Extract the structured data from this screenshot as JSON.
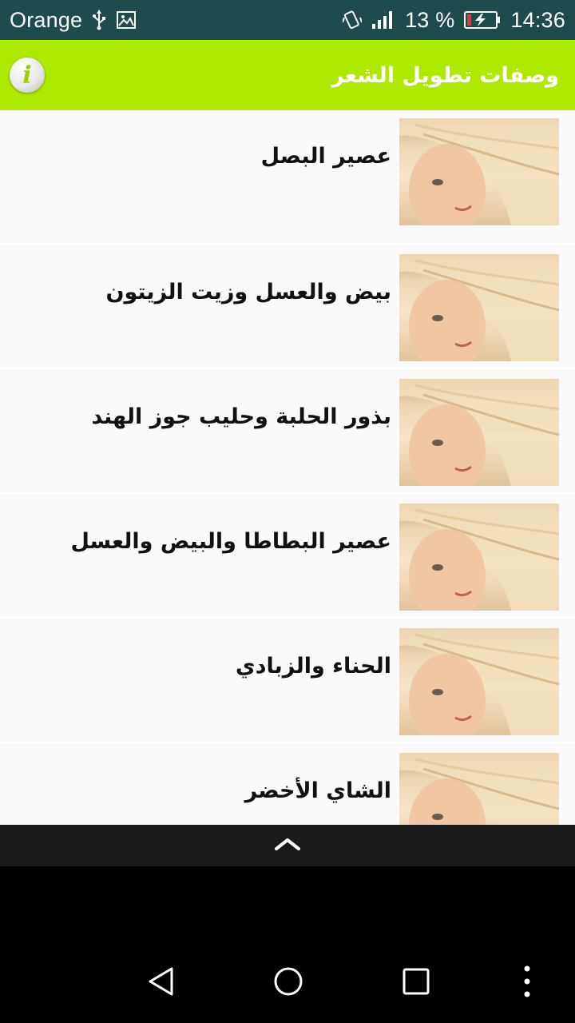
{
  "status_bar": {
    "carrier": "Orange",
    "battery_percent": "13 %",
    "time": "14:36",
    "icons": [
      "usb-icon",
      "image-icon",
      "vibrate-icon",
      "signal-icon",
      "battery-charging-icon"
    ]
  },
  "app_bar": {
    "title": "وصفات تطويل الشعر",
    "info_icon": "info-icon",
    "info_glyph": "i"
  },
  "list": {
    "items": [
      {
        "label": "عصير البصل"
      },
      {
        "label": "بيض والعسل وزيت الزيتون"
      },
      {
        "label": "بذور الحلبة وحليب جوز الهند"
      },
      {
        "label": "عصير البطاطا والبيض والعسل"
      },
      {
        "label": "الحناء والزبادي"
      },
      {
        "label": "الشاي الأخضر"
      }
    ]
  },
  "navigation": {
    "expand_icon": "chevron-up-icon",
    "buttons": [
      "back-icon",
      "home-icon",
      "recents-icon",
      "menu-dots-icon"
    ]
  },
  "colors": {
    "status_bar": "#1e4c4c",
    "app_bar": "#aee900",
    "list_background": "#fafafa"
  }
}
